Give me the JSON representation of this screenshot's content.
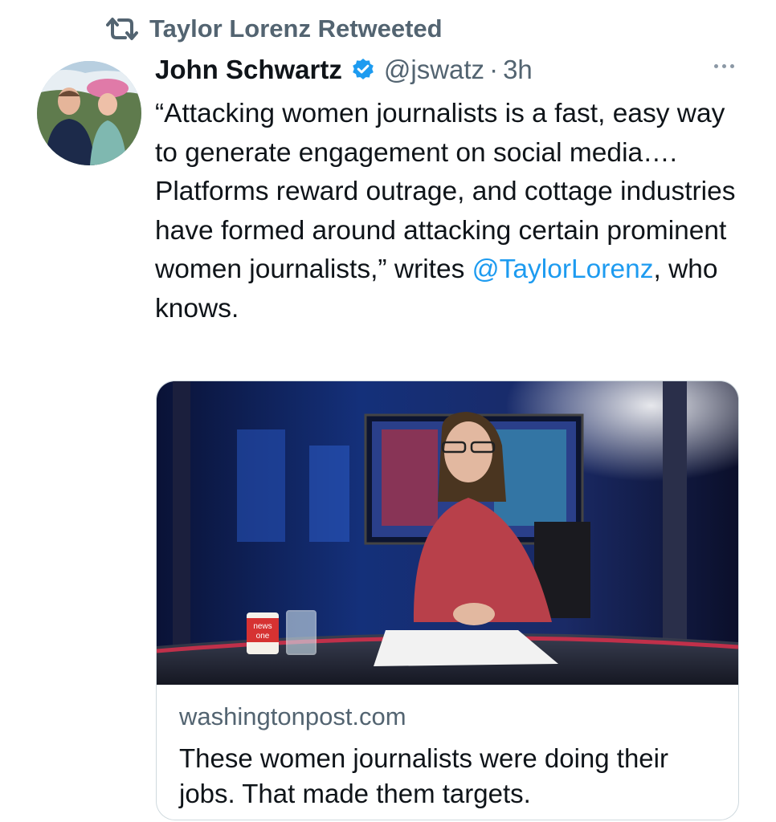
{
  "retweet": {
    "icon": "retweet-icon",
    "label": "Taylor Lorenz Retweeted"
  },
  "author": {
    "name": "John Schwartz",
    "verified": true,
    "handle": "@jswatz",
    "separator": "·",
    "time": "3h"
  },
  "tweet": {
    "text_before": "“Attacking women journalists is a fast, easy way to generate engagement on social media…. Platforms reward outrage, and cottage industries have formed around attacking certain prominent women journalists,” writes ",
    "mention": "@TaylorLorenz",
    "text_after": ", who knows."
  },
  "card": {
    "mug_text_line1": "news",
    "mug_text_line2": "one",
    "domain": "washingtonpost.com",
    "title": "These women journalists were doing their jobs. That made them targets."
  },
  "colors": {
    "link": "#1d9bf0",
    "secondary_text": "#536471",
    "verified": "#1d9bf0"
  }
}
